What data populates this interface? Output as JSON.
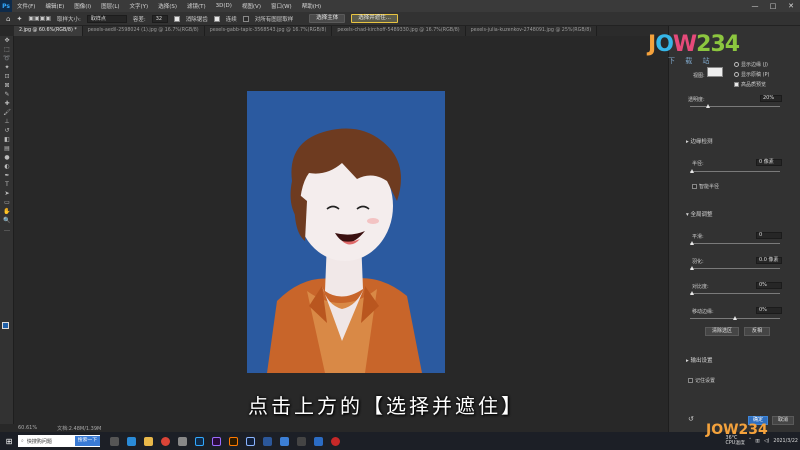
{
  "app": {
    "logo_text": "Ps"
  },
  "menu": [
    "文件(F)",
    "编辑(E)",
    "图像(I)",
    "图层(L)",
    "文字(Y)",
    "选择(S)",
    "滤镜(T)",
    "3D(D)",
    "视图(V)",
    "窗口(W)",
    "帮助(H)"
  ],
  "window_controls": {
    "minimize": "—",
    "maximize": "□",
    "close": "✕"
  },
  "options": {
    "size_label": "取样大小:",
    "size_value": "取样点",
    "tolerance_label": "容差:",
    "tolerance_value": "32",
    "antialias_label": "消除锯齿",
    "contiguous_label": "连续",
    "all_layers_label": "对所有图层取样",
    "select_subject": "选择主体",
    "select_and_mask": "选择并遮住..."
  },
  "tabs": [
    {
      "label": "2.jpg @ 60.6%(RGB/8) *",
      "active": true
    },
    {
      "label": "pexels-aedil-2598024 (1).jpg @ 16.7%(RGB/8)",
      "active": false
    },
    {
      "label": "pexels-gabb-tapic-3568543.jpg @ 16.7%(RGB/8)",
      "active": false
    },
    {
      "label": "pexels-chad-kirchoff-5489330.jpg @ 16.7%(RGB/8)",
      "active": false
    },
    {
      "label": "pexels-julia-kuzenkov-2748091.jpg @ 25%(RGB/8)",
      "active": false
    }
  ],
  "subtitle": "点击上方的【选择并遮住】",
  "status": {
    "zoom": "60.61%",
    "doc_info": "文档:2.48M/1.39M"
  },
  "watermark": {
    "logo": [
      "J",
      "O",
      "W",
      "234"
    ],
    "sub": "下 载 站",
    "bottom_logo": "JOW234"
  },
  "panel": {
    "view_label": "视图:",
    "show_edge": "显示边缘 (J)",
    "show_original": "显示原稿 (P)",
    "high_quality": "高品质预览",
    "opacity_label": "透明度:",
    "opacity_value": "20%",
    "edge_detection": "边缘检测",
    "radius_label": "半径:",
    "radius_value": "0 像素",
    "smart_radius": "智能半径",
    "global_refine": "全局调整",
    "smooth_label": "平滑:",
    "smooth_value": "0",
    "feather_label": "羽化:",
    "feather_value": "0.0 像素",
    "contrast_label": "对比度:",
    "contrast_value": "0%",
    "shift_edge_label": "移动边缘:",
    "shift_edge_value": "0%",
    "clear_selection": "清除选区",
    "invert": "反相",
    "output_settings": "输出设置",
    "remember_settings": "记住设置",
    "ok": "确定",
    "cancel": "取消"
  },
  "taskbar": {
    "search_text": "快搜购问题",
    "search_button": "搜索一下",
    "temperature": "36°C",
    "cpu_label": "CPU温度",
    "date": "2021/3/22"
  },
  "colors": {
    "artwork_bg": "#2b5aa0",
    "foreground": "#1e5fa8",
    "primary_button": "#2f6fbf"
  }
}
